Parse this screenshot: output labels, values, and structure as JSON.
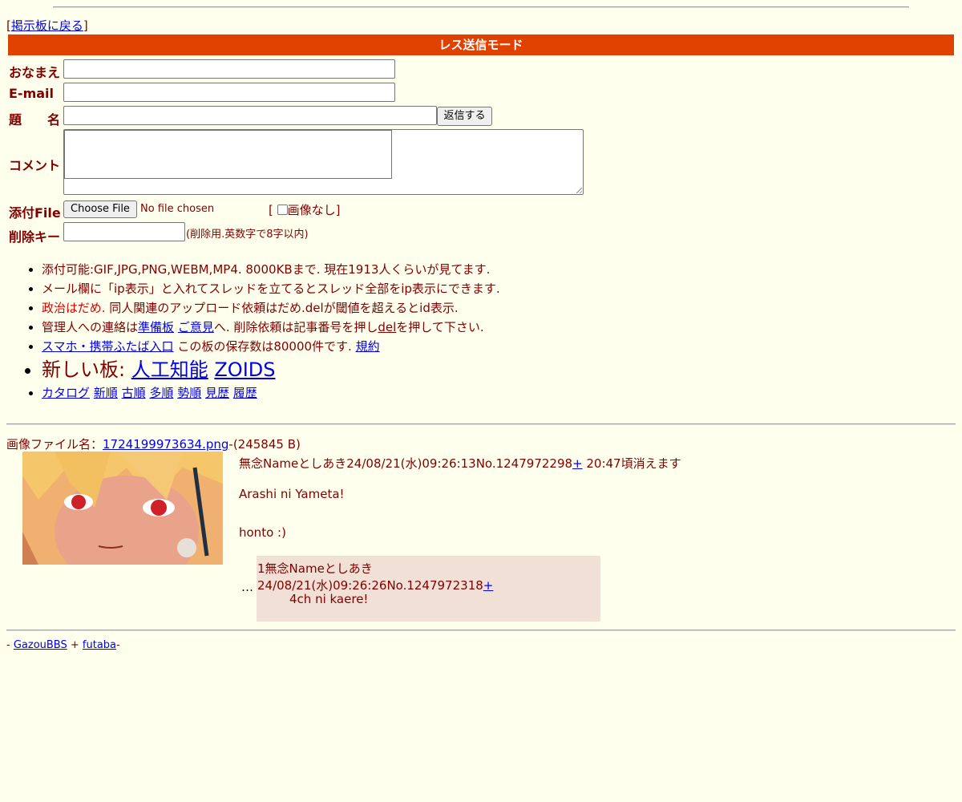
{
  "nav": {
    "open": "[",
    "back_link": "掲示板に戻る",
    "close": "]"
  },
  "form": {
    "header": "レス送信モード",
    "name_label": "おなまえ",
    "email_label": "E-mail",
    "subject_label": "題　　名",
    "submit_button": "返信する",
    "comment_label": "コメント",
    "file_label": "添付File",
    "file_button": "Choose File",
    "file_status": "No file chosen",
    "noimage_open": "[",
    "noimage_label": "画像なし",
    "noimage_close": "]",
    "delkey_label": "削除キー",
    "delkey_note": "(削除用.英数字で8字以内)"
  },
  "rules": {
    "r1": "添付可能:GIF,JPG,PNG,WEBM,MP4. 8000KBまで. 現在1913人くらいが見てます.",
    "r2": "メール欄に「ip表示」と入れてスレッドを立てるとスレッド全部をip表示にできます.",
    "r3_red": "政治はだめ.",
    "r3_rest": " 同人関連のアップロード依頼はだめ.delが閾値を超えるとid表示.",
    "r4_a": "管理人への連絡は",
    "r4_link1": "準備板",
    "r4_link2": "ご意見",
    "r4_b": "へ. 削除依頼は記事番号を押し",
    "r4_del": "del",
    "r4_c": "を押して下さい.",
    "r5_link": "スマホ・携帯ふたば入口",
    "r5_text": " この板の保存数は80000件です. ",
    "r5_kiyaku": "規約",
    "r6_text": "新しい板: ",
    "r6_link1": "人工知能",
    "r6_link2": "ZOIDS",
    "r7_links": [
      "カタログ",
      "新順",
      "古順",
      "多順",
      "勢順",
      "見歴",
      "履歴"
    ]
  },
  "thread": {
    "file_prefix": "画像ファイル名：",
    "file_name": "1724199973634.png",
    "file_size": "-(245845 B)",
    "op_header": "無念Nameとしあき24/08/21(水)09:26:13No.1247972298",
    "op_plus": "+",
    "op_expire": " 20:47頃消えます",
    "op_body1": "Arashi ni Yameta!",
    "op_body2": "honto :)",
    "ellipsis": "…",
    "reply_header": "1無念Nameとしあき24/08/21(水)09:26:26No.1247972318",
    "reply_plus": "+",
    "reply_body": "4ch ni kaere!"
  },
  "footer": {
    "prefix": "- ",
    "link1": "GazouBBS",
    "plus": " + ",
    "link2": "futaba",
    "suffix": "-"
  },
  "colors": {
    "header_bg": "#e04000",
    "background": "#ffffee",
    "text": "#800000",
    "reply_bg": "#f0e0d6"
  },
  "icons": {
    "thumbnail": "anime-character-thumbnail"
  }
}
